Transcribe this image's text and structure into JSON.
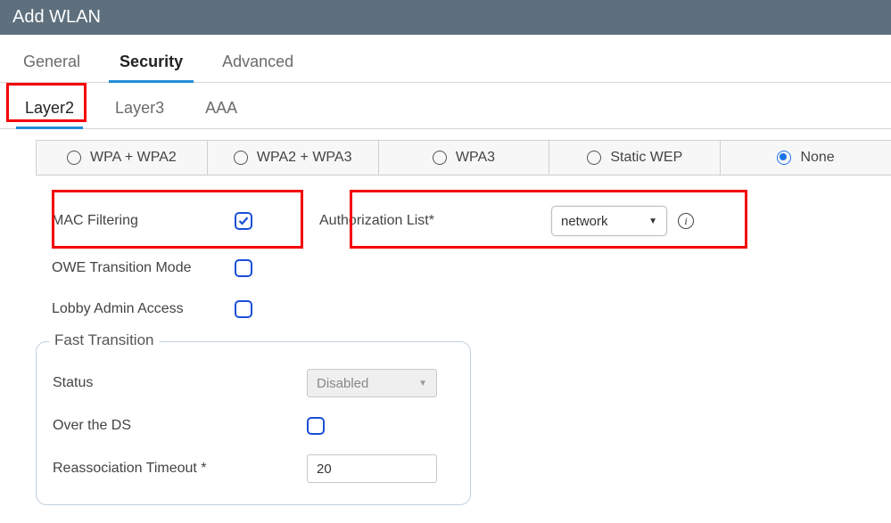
{
  "header": {
    "title": "Add WLAN"
  },
  "main_tabs": [
    {
      "label": "General"
    },
    {
      "label": "Security"
    },
    {
      "label": "Advanced"
    }
  ],
  "main_tab_active": "Security",
  "sub_tabs": [
    {
      "label": "Layer2"
    },
    {
      "label": "Layer3"
    },
    {
      "label": "AAA"
    }
  ],
  "sub_tab_active": "Layer2",
  "security_mode_options": [
    {
      "label": "WPA + WPA2",
      "selected": false
    },
    {
      "label": "WPA2 + WPA3",
      "selected": false
    },
    {
      "label": "WPA3",
      "selected": false
    },
    {
      "label": "Static WEP",
      "selected": false
    },
    {
      "label": "None",
      "selected": true
    }
  ],
  "layer2": {
    "mac_filtering_label": "MAC Filtering",
    "mac_filtering_checked": true,
    "authorization_list_label": "Authorization List*",
    "authorization_list_value": "network",
    "owe_label": "OWE Transition Mode",
    "owe_checked": false,
    "lobby_label": "Lobby Admin Access",
    "lobby_checked": false
  },
  "fast_transition": {
    "legend": "Fast Transition",
    "status_label": "Status",
    "status_value": "Disabled",
    "over_ds_label": "Over the DS",
    "over_ds_checked": false,
    "reassoc_label": "Reassociation Timeout *",
    "reassoc_value": "20"
  }
}
